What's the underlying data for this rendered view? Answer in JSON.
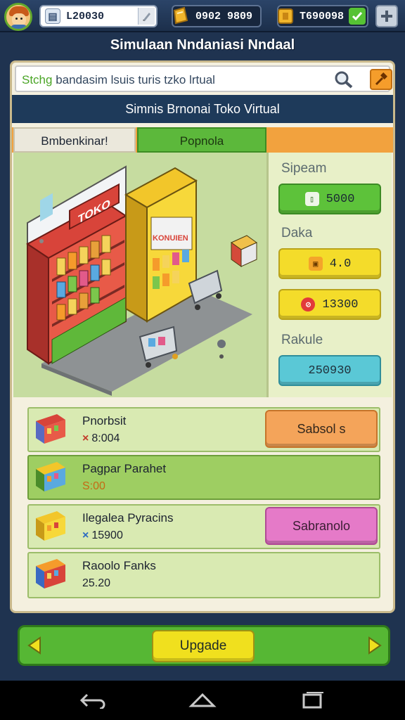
{
  "topbar": {
    "field_value": "L20030",
    "stat1_value": "0902 9809",
    "stat2_value": "T690098",
    "check_icon": "check-icon",
    "plus_icon": "plus-icon"
  },
  "title": "Simulaan Nndaniasi Nndaal",
  "search": {
    "prefix": "Stchg",
    "text": " bandasim lsuis turis tzko lrtual"
  },
  "subheader": "Simnis Brnonai Toko Virtual",
  "tabs": [
    {
      "label": "Bmbenkinar!"
    },
    {
      "label": "Popnola"
    }
  ],
  "scene": {
    "sign_toko": "TOKO",
    "sign_konuien": "KONUIEN"
  },
  "side": {
    "label1": "Sipeam",
    "btn1": "5000",
    "label2": "Daka",
    "btn2": "4.0",
    "btn3": "13300",
    "label3": "Rakule",
    "btn4": "250930"
  },
  "shop": [
    {
      "name": "Pnorbsit",
      "symbol": "×",
      "price": "8:004",
      "button": "Sabsol s"
    },
    {
      "name": "Pagpar Parahet",
      "symbol": "",
      "price": "S:00",
      "button": ""
    },
    {
      "name": "Ilegalea Pyracins",
      "symbol": "×",
      "price": "15900",
      "button": "Sabranolo"
    },
    {
      "name": "Raoolo Fanks",
      "symbol": "",
      "price": "25.20",
      "button": ""
    }
  ],
  "actionbar": {
    "upgrade": "Upgade"
  },
  "colors": {
    "accent_green": "#56b734",
    "accent_yellow": "#f0e01e",
    "accent_orange": "#f4a45a",
    "accent_pink": "#e57ac8",
    "header_navy": "#1e3a5a"
  }
}
